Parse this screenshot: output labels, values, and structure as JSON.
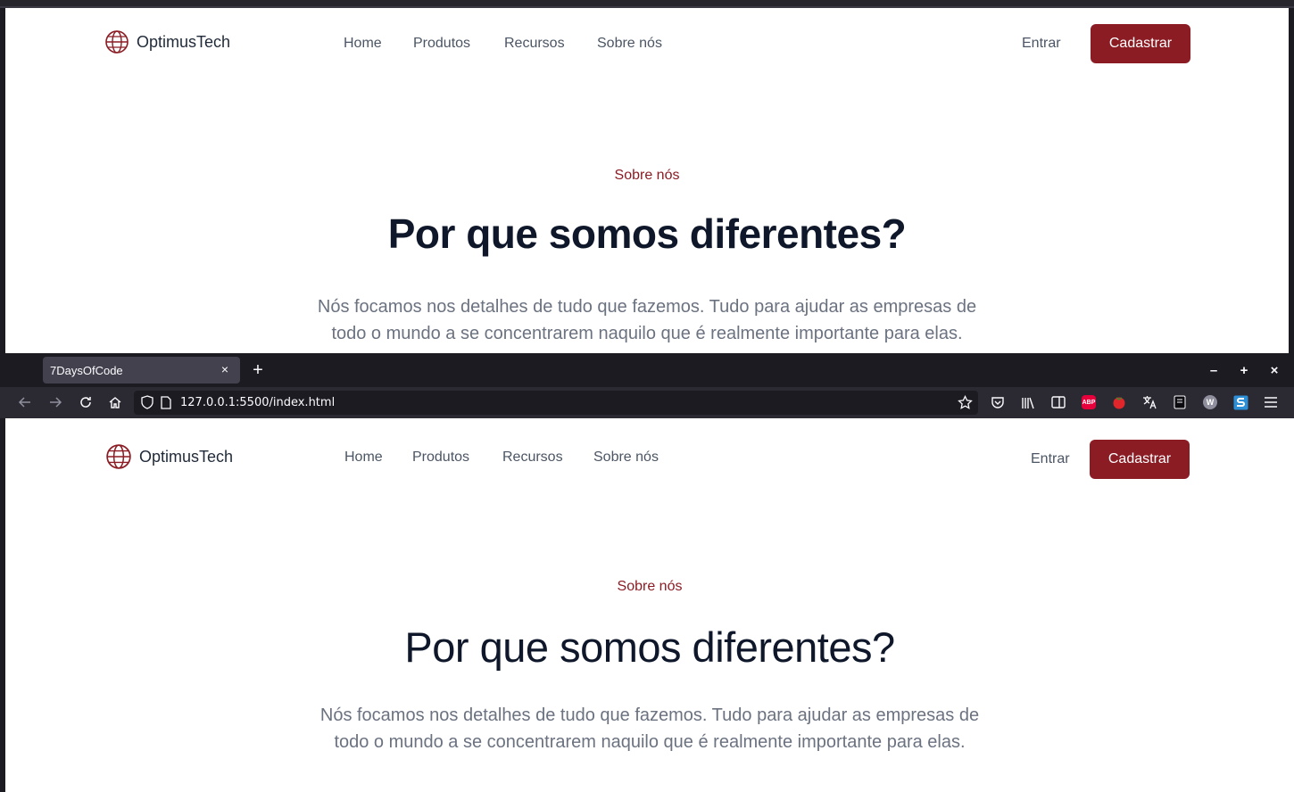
{
  "site": {
    "logo_text": "OptimusTech",
    "nav": [
      "Home",
      "Produtos",
      "Recursos",
      "Sobre nós"
    ],
    "signin_label": "Entrar",
    "signup_label": "Cadastrar",
    "section": {
      "eyebrow": "Sobre nós",
      "headline": "Por que somos diferentes?",
      "lead_line1": "Nós focamos nos detalhes de tudo que fazemos. Tudo para ajudar as empresas de",
      "lead_line2": "todo o mundo a se concentrarem naquilo que é realmente importante para elas."
    }
  },
  "browser": {
    "tab_title": "7DaysOfCode",
    "tab_close": "×",
    "new_tab": "+",
    "window": {
      "minimize": "–",
      "maximize": "+",
      "close": "×"
    },
    "url": "127.0.0.1:5500/index.html",
    "toolbar_icons": [
      "back-icon",
      "forward-icon",
      "reload-icon",
      "home-icon",
      "shield-icon",
      "page-icon",
      "bookmark-star-icon",
      "pocket-icon",
      "library-icon",
      "sidebar-icon",
      "adblock-plus-icon",
      "tomato-extension-icon",
      "translate-icon",
      "notes-icon",
      "w-extension-icon",
      "s-extension-icon",
      "menu-icon"
    ],
    "extension_badges": {
      "adblock": "ABP",
      "w": "W"
    }
  },
  "colors": {
    "brand": "#8b1c24",
    "heading": "#0f172a",
    "body_text": "#6b7280",
    "nav_text": "#4b5563",
    "chrome_dark": "#1c1b22",
    "chrome_toolbar": "#2b2a33"
  }
}
